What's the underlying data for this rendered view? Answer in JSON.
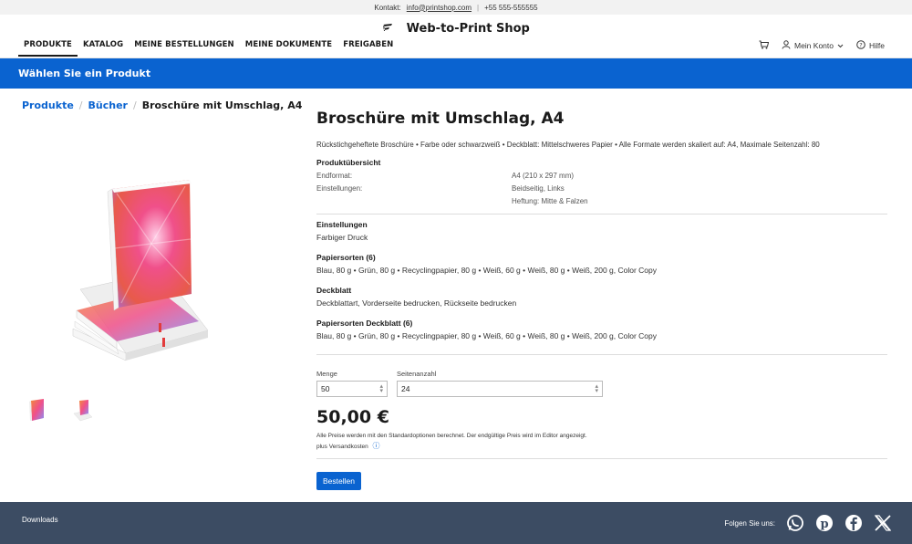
{
  "topbar": {
    "contact_label": "Kontakt:",
    "email": "info@printshop.com",
    "separator": "|",
    "phone": "+55 555-555555"
  },
  "header": {
    "brand": "Web-to-Print Shop",
    "nav": [
      "PRODUKTE",
      "KATALOG",
      "MEINE BESTELLUNGEN",
      "MEINE DOKUMENTE",
      "FREIGABEN"
    ],
    "account": "Mein Konto",
    "help": "Hilfe"
  },
  "banner": {
    "title": "Wählen Sie ein Produkt"
  },
  "breadcrumb": {
    "items": [
      "Produkte",
      "Bücher"
    ],
    "current": "Broschüre mit Umschlag, A4",
    "sep": "/"
  },
  "product": {
    "title": "Broschüre mit Umschlag, A4",
    "description": "Rückstichgeheftete Broschüre • Farbe oder schwarzweiß • Deckblatt: Mittelschweres Papier • Alle Formate werden skaliert auf: A4, Maximale Seitenzahl: 80",
    "overview": {
      "title": "Produktübersicht",
      "format_label": "Endformat:",
      "format_value": "A4 (210 x 297 mm)",
      "settings_label": "Einstellungen:",
      "settings_value1": "Beidseitig, Links",
      "settings_value2": "Heftung: Mitte & Falzen"
    },
    "sections": [
      {
        "title": "Einstellungen",
        "value": "Farbiger Druck"
      },
      {
        "title": "Papiersorten (6)",
        "value": "Blau, 80 g • Grün, 80 g • Recyclingpapier, 80 g • Weiß, 60 g • Weiß, 80 g • Weiß, 200 g, Color Copy"
      },
      {
        "title": "Deckblatt",
        "value": "Deckblattart, Vorderseite bedrucken, Rückseite bedrucken"
      },
      {
        "title": "Papiersorten Deckblatt (6)",
        "value": "Blau, 80 g • Grün, 80 g • Recyclingpapier, 80 g • Weiß, 60 g • Weiß, 80 g • Weiß, 200 g, Color Copy"
      }
    ]
  },
  "form": {
    "quantity_label": "Menge",
    "quantity_value": "50",
    "pages_label": "Seitenanzahl",
    "pages_value": "24"
  },
  "price": {
    "value": "50,00 €",
    "note": "Alle Preise werden mit den Standardoptionen berechnet. Der endgültige Preis wird im Editor angezeigt.",
    "shipping": "plus Versandkosten"
  },
  "order_button": "Bestellen",
  "footer": {
    "downloads": "Downloads",
    "follow": "Folgen Sie uns:"
  },
  "colors": {
    "accent": "#0a63d0",
    "footer": "#3c4c63"
  }
}
